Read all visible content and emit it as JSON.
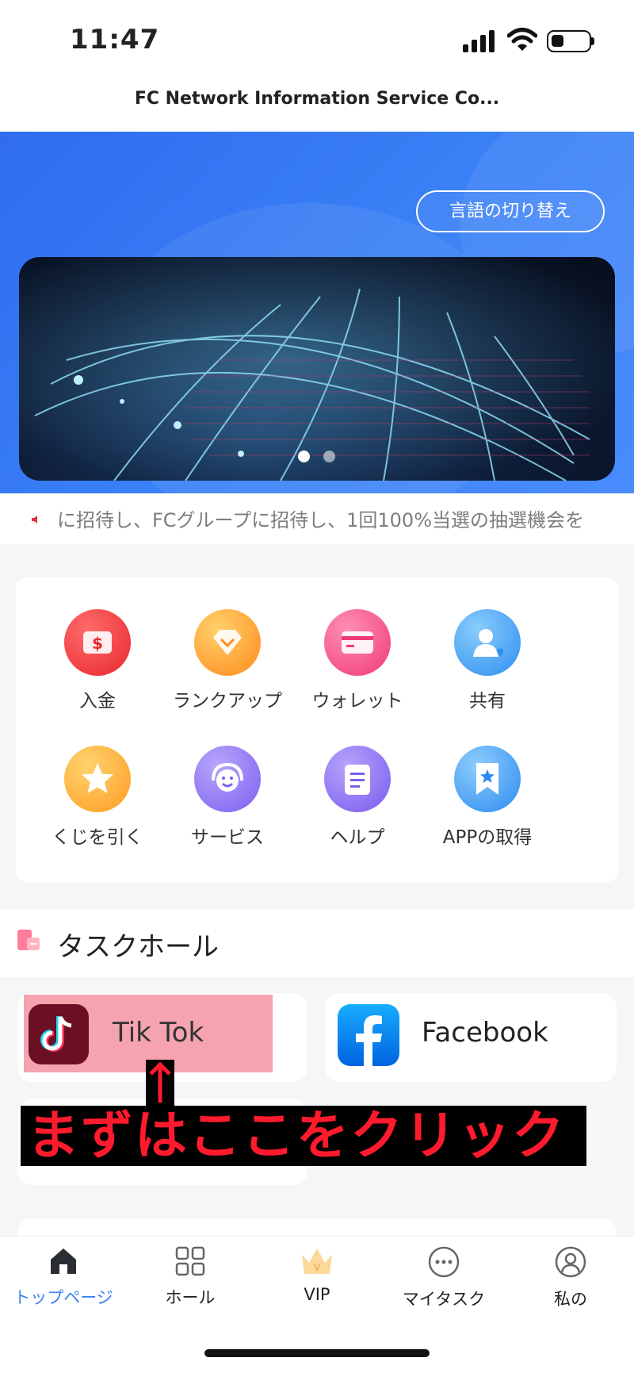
{
  "status_bar": {
    "time": "11:47"
  },
  "header": {
    "title": "FC Network Information Service Co..."
  },
  "hero": {
    "language_button": "言語の切り替え",
    "carousel_active_index": 0,
    "carousel_count": 2
  },
  "marquee": {
    "text": "に招待し、FCグループに招待し、1回100%当選の抽選機会を"
  },
  "menu": {
    "items": [
      {
        "label": "入金",
        "icon": "deposit-icon",
        "color": "#f0353b"
      },
      {
        "label": "ランクアップ",
        "icon": "rank-up-icon",
        "color": "#ff9d2e"
      },
      {
        "label": "ウォレット",
        "icon": "wallet-icon",
        "color": "#f3487d"
      },
      {
        "label": "共有",
        "icon": "share-icon",
        "color": "#3a9df2"
      },
      {
        "label": "くじを引く",
        "icon": "lottery-icon",
        "color": "#ffa92e"
      },
      {
        "label": "サービス",
        "icon": "service-icon",
        "color": "#8d6ef2"
      },
      {
        "label": "ヘルプ",
        "icon": "help-icon",
        "color": "#8a6cf0"
      },
      {
        "label": "APPの取得",
        "icon": "get-app-icon",
        "color": "#3b9cf3"
      }
    ]
  },
  "task_hall": {
    "title": "タスクホール",
    "tasks": [
      {
        "label": "Tik Tok",
        "icon": "tiktok-icon"
      },
      {
        "label": "Facebook",
        "icon": "facebook-icon"
      }
    ]
  },
  "annotation": {
    "arrow": "↑",
    "text": "まずはここをクリック"
  },
  "tab_bar": {
    "tabs": [
      {
        "label": "トップページ",
        "icon": "home-icon",
        "active": true
      },
      {
        "label": "ホール",
        "icon": "grid-icon",
        "active": false
      },
      {
        "label": "VIP",
        "icon": "crown-icon",
        "active": false
      },
      {
        "label": "マイタスク",
        "icon": "more-icon",
        "active": false
      },
      {
        "label": "私の",
        "icon": "profile-icon",
        "active": false
      }
    ],
    "active_color": "#3b82f6"
  }
}
